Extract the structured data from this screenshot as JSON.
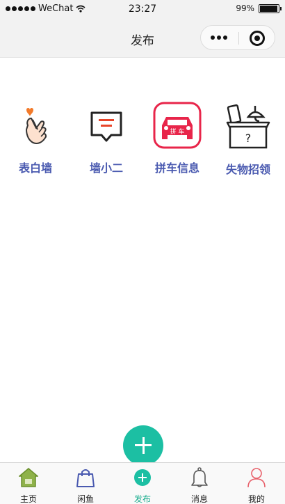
{
  "status_bar": {
    "carrier": "WeChat",
    "time": "23:27",
    "battery": "99%"
  },
  "nav": {
    "title": "发布"
  },
  "categories": [
    {
      "label": "表白墙",
      "icon": "finger-heart-icon"
    },
    {
      "label": "墙小二",
      "icon": "message-box-icon"
    },
    {
      "label": "拼车信息",
      "icon": "car-icon",
      "badge": "拼 车"
    },
    {
      "label": "失物招领",
      "icon": "lost-box-icon"
    }
  ],
  "tabs": [
    {
      "label": "主页",
      "icon": "home-icon",
      "active": false
    },
    {
      "label": "闲鱼",
      "icon": "shopping-bag-icon",
      "active": false
    },
    {
      "label": "发布",
      "icon": "add-circle-icon",
      "active": true
    },
    {
      "label": "消息",
      "icon": "bell-icon",
      "active": false
    },
    {
      "label": "我的",
      "icon": "person-icon",
      "active": false
    }
  ],
  "colors": {
    "accent": "#1cbfa3",
    "label_blue": "#4a5ab0",
    "car_red": "#e8254a",
    "heart_orange": "#f27a2a",
    "tab_active": "#1aad8e"
  }
}
